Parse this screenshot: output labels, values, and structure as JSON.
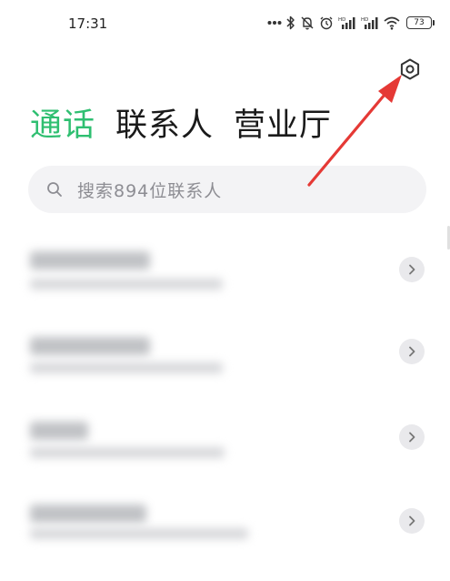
{
  "status_bar": {
    "time": "17:31",
    "battery": "73",
    "icons": [
      "more-dots-icon",
      "bluetooth-icon",
      "silent-icon",
      "alarm-icon",
      "hd-signal-icon",
      "hd-signal-icon",
      "wifi-icon",
      "battery-icon"
    ]
  },
  "header": {
    "settings_icon": "gear-icon"
  },
  "tabs": [
    {
      "label": "通话",
      "active": true
    },
    {
      "label": "联系人",
      "active": false
    },
    {
      "label": "营业厅",
      "active": false
    }
  ],
  "search": {
    "placeholder": "搜索894位联系人",
    "icon": "search-icon"
  },
  "contacts": [
    {
      "name": "",
      "blurred": true
    },
    {
      "name": "",
      "blurred": true
    },
    {
      "name": "",
      "blurred": true
    },
    {
      "name": "",
      "blurred": true
    }
  ],
  "colors": {
    "accent": "#2fbf71",
    "annotation": "#e53935",
    "search_bg": "#f3f3f5"
  }
}
